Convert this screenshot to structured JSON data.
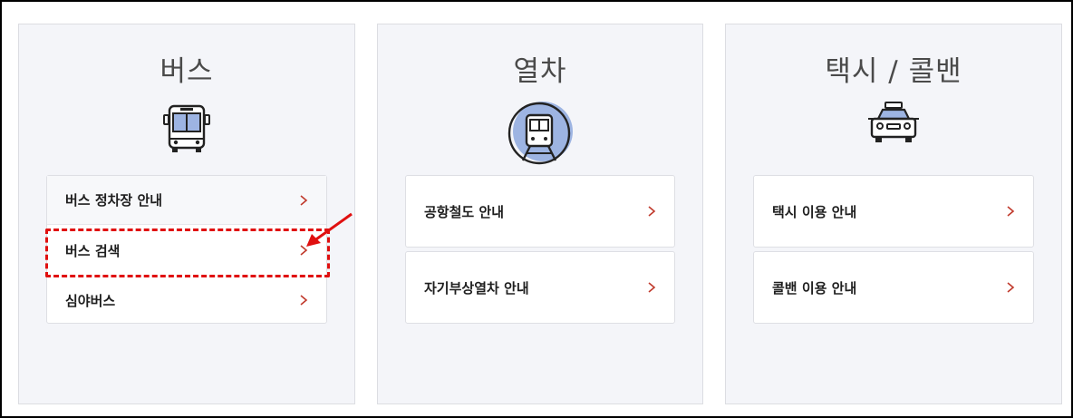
{
  "panels": {
    "bus": {
      "title": "버스",
      "items": [
        {
          "label": "버스 정차장 안내"
        },
        {
          "label": "버스 검색"
        },
        {
          "label": "심야버스"
        }
      ]
    },
    "train": {
      "title": "열차",
      "items": [
        {
          "label": "공항철도 안내"
        },
        {
          "label": "자기부상열차 안내"
        }
      ]
    },
    "taxi": {
      "title": "택시 / 콜밴",
      "items": [
        {
          "label": "택시 이용 안내"
        },
        {
          "label": "콜밴 이용 안내"
        }
      ]
    }
  },
  "colors": {
    "panel_bg": "#f4f5f9",
    "icon_accent": "#9db4e2",
    "chevron": "#c0392b",
    "highlight": "#e01010"
  },
  "annotation": {
    "highlighted_item": "bus-search",
    "icon": "red-arrow-icon"
  }
}
